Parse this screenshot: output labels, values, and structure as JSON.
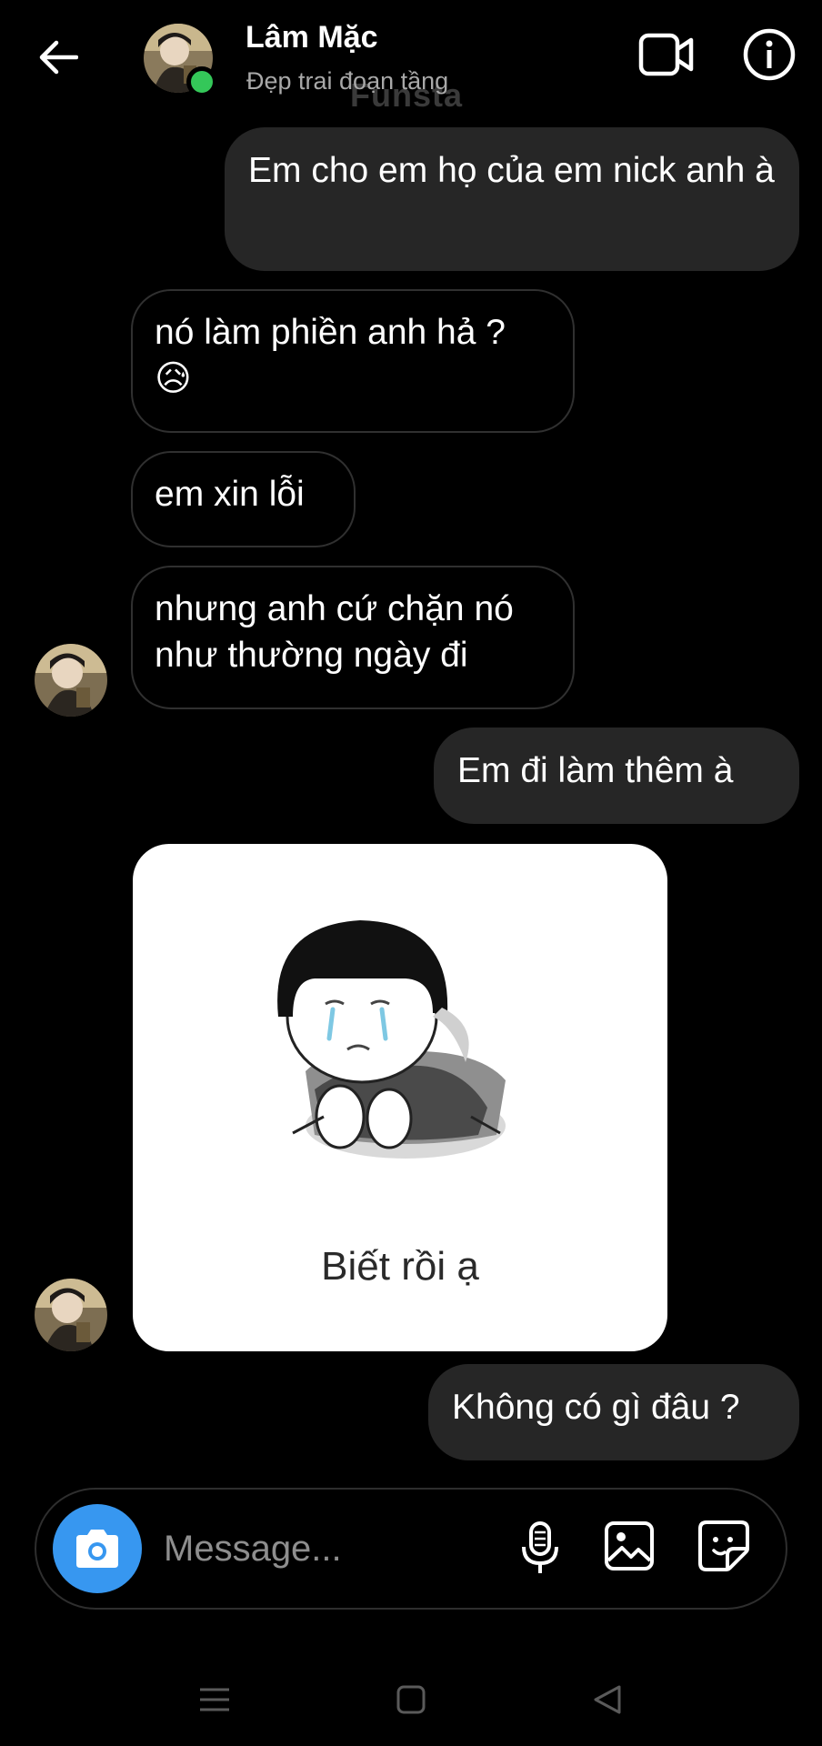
{
  "header": {
    "contact_name": "Lâm Mặc",
    "contact_status": "Đẹp trai đoạn tầng",
    "watermark": "Funsta"
  },
  "messages": [
    {
      "direction": "out",
      "text": "Em cho em họ của em nick anh à"
    },
    {
      "direction": "in",
      "text": "nó làm phiền anh hả ? 😥"
    },
    {
      "direction": "in",
      "text": "em xin lỗi"
    },
    {
      "direction": "in",
      "text": "nhưng anh cứ chặn nó như thường ngày đi"
    },
    {
      "direction": "out",
      "text": "Em đi làm thêm à"
    },
    {
      "direction": "in",
      "type": "sticker",
      "caption": "Biết rồi ạ"
    },
    {
      "direction": "out",
      "text": "Không có gì đâu ?"
    }
  ],
  "composer": {
    "placeholder": "Message..."
  },
  "colors": {
    "background": "#000000",
    "outgoing_bubble": "#262626",
    "incoming_border": "#303030",
    "accent": "#3797f0",
    "online": "#34c759"
  },
  "icons": [
    "back-arrow-icon",
    "video-call-icon",
    "info-icon",
    "camera-icon",
    "microphone-icon",
    "gallery-icon",
    "sticker-icon",
    "recents-icon",
    "home-icon",
    "back-nav-icon"
  ]
}
